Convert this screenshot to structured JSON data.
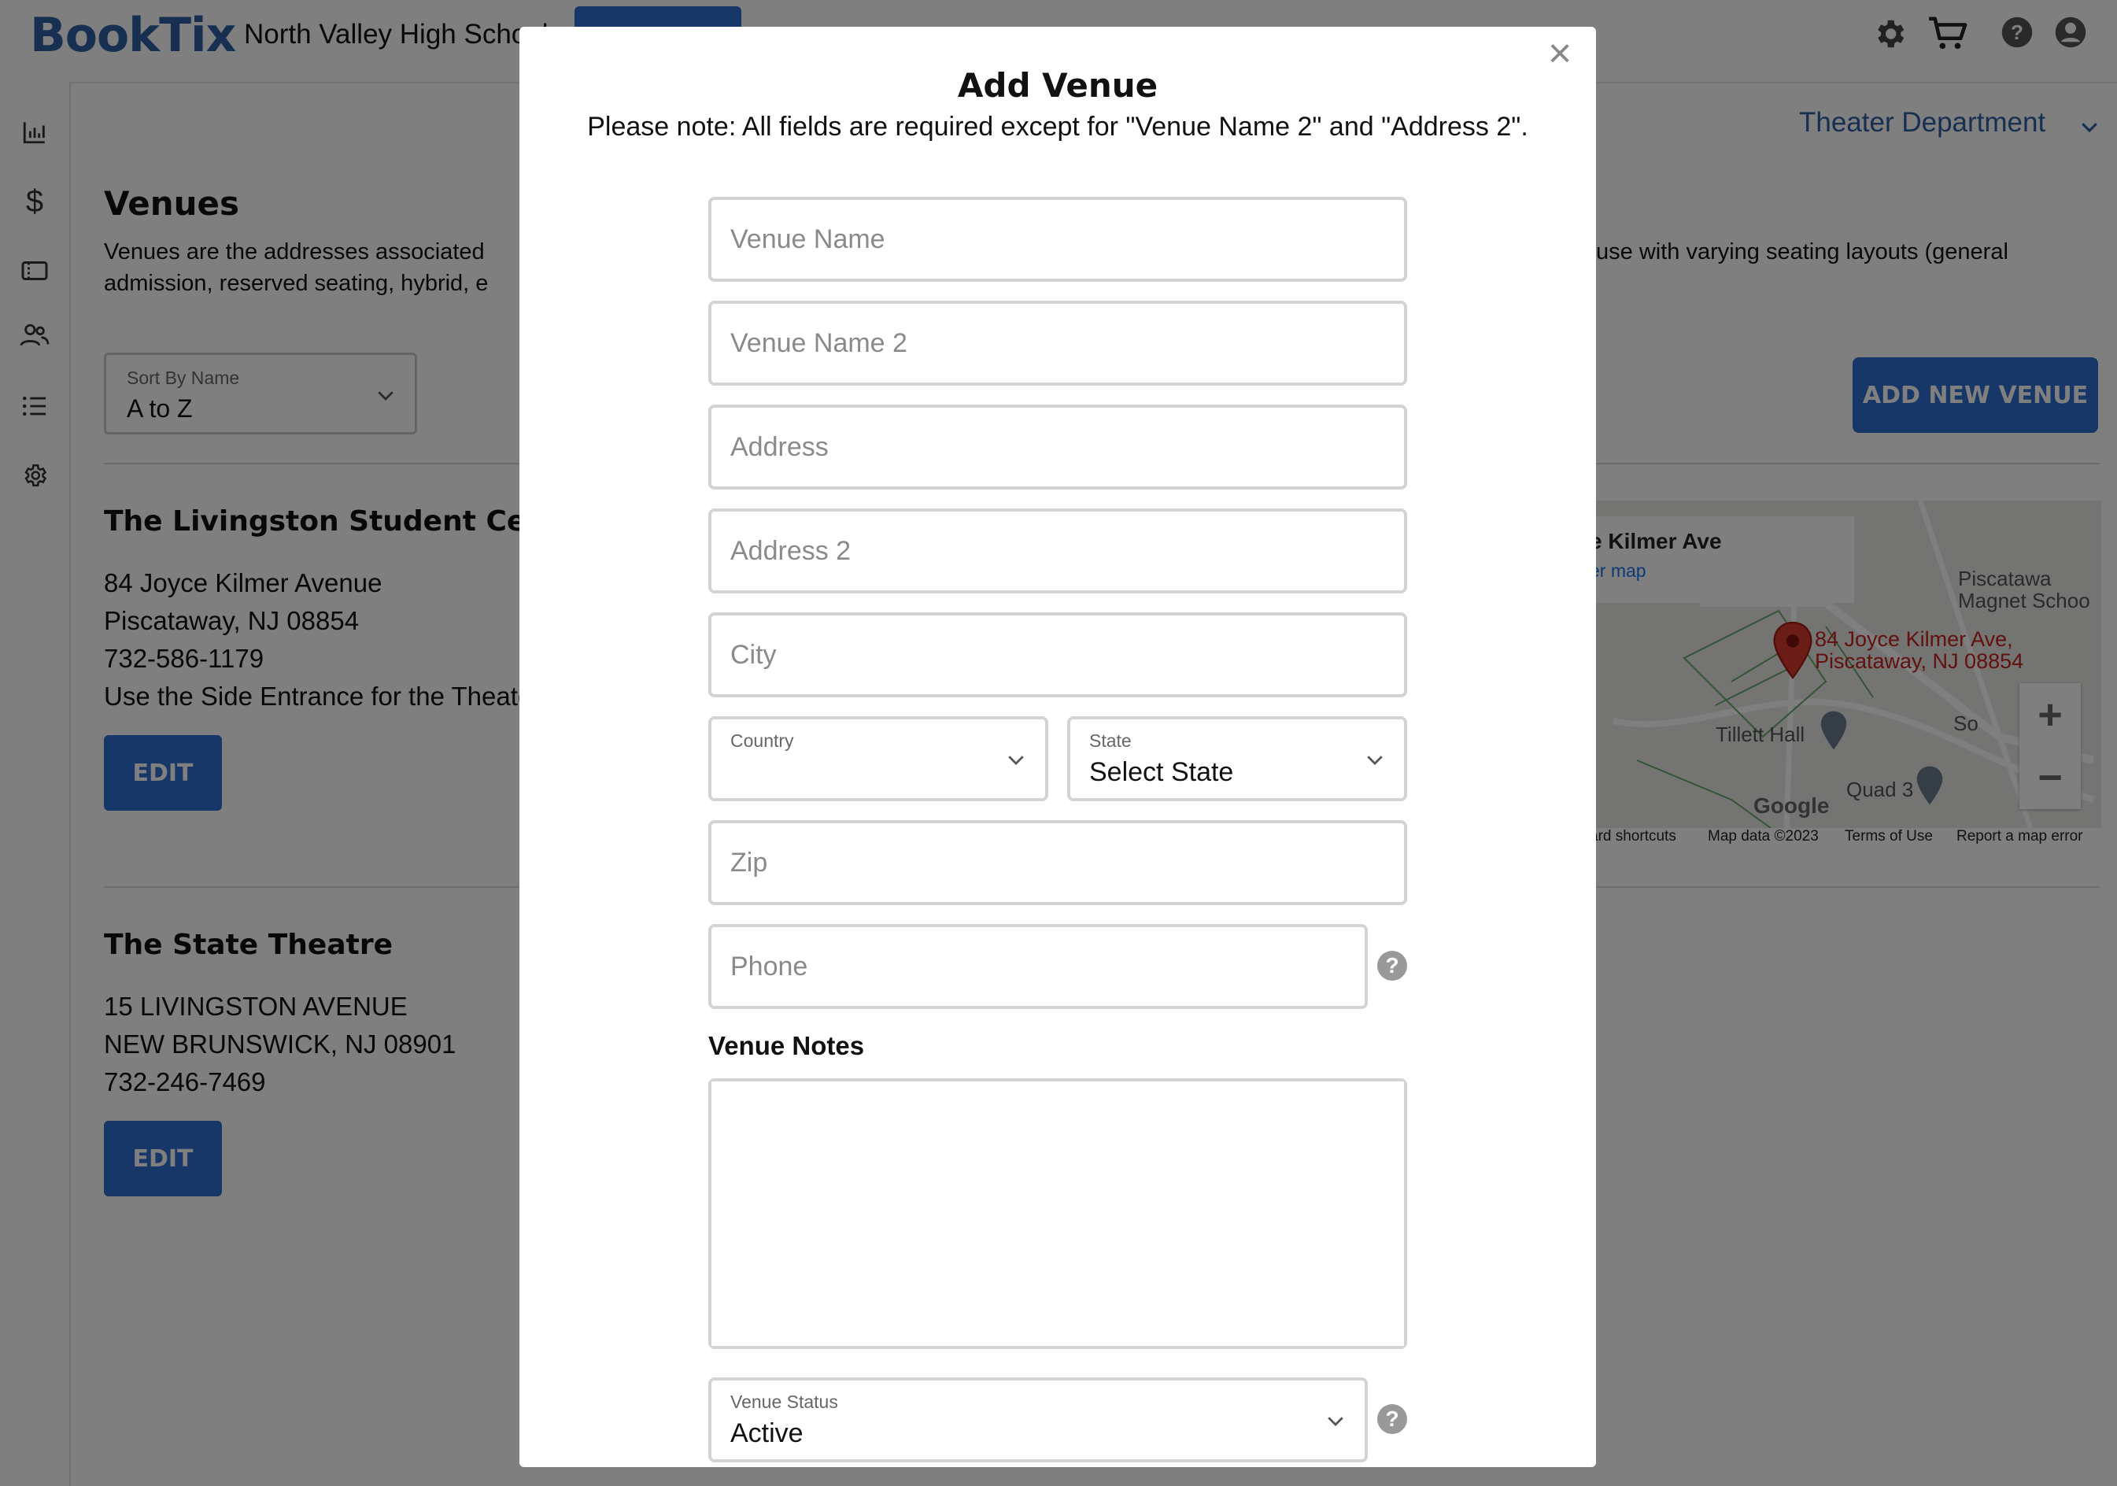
{
  "app": {
    "logo": "BookTix",
    "organization": "North Valley High School",
    "department": "Theater Department"
  },
  "page": {
    "title": "Venues",
    "intro_line1_left": "Venues are the addresses associated",
    "intro_line1_right": "use with varying seating layouts (general",
    "intro_line2_left": "admission, reserved seating, hybrid, e",
    "sort": {
      "label": "Sort By Name",
      "value": "A to Z"
    },
    "add_button": "ADD NEW VENUE"
  },
  "venues": [
    {
      "name": "The Livingston Student Center",
      "lines": [
        "84 Joyce Kilmer Avenue",
        "Piscataway, NJ 08854",
        "732-586-1179",
        "Use the Side Entrance for the Theater"
      ],
      "edit_label": "EDIT"
    },
    {
      "name": "The State Theatre",
      "lines": [
        "15 LIVINGSTON AVENUE",
        "NEW BRUNSWICK, NJ 08901",
        "732-246-7469"
      ],
      "edit_label": "EDIT"
    }
  ],
  "map": {
    "card_title": "e Kilmer Ave",
    "card_link": "er map",
    "pin_label_line1": "84 Joyce Kilmer Ave,",
    "pin_label_line2": "Piscataway, NJ 08854",
    "labels": [
      "Piscatawa",
      "Magnet Schoo",
      "Tillett Hall",
      "Quad 3",
      "So"
    ],
    "google": "Google",
    "footer": [
      "ard shortcuts",
      "Map data ©2023",
      "Terms of Use",
      "Report a map error"
    ],
    "zoom_in": "+",
    "zoom_out": "−"
  },
  "modal": {
    "title": "Add Venue",
    "note": "Please note: All fields are required except for \"Venue Name 2\" and \"Address 2\".",
    "close": "×",
    "fields": {
      "venue_name": "Venue Name",
      "venue_name_2": "Venue Name 2",
      "address": "Address",
      "address_2": "Address 2",
      "city": "City",
      "zip": "Zip",
      "phone": "Phone"
    },
    "country": {
      "label": "Country",
      "value": ""
    },
    "state": {
      "label": "State",
      "value": "Select State"
    },
    "notes_label": "Venue Notes",
    "status": {
      "label": "Venue Status",
      "value": "Active"
    },
    "help_glyph": "?"
  },
  "colors": {
    "brand": "#2f5fa3",
    "button": "#2f6fd1",
    "overlay": "rgba(0,0,0,0.5)"
  }
}
